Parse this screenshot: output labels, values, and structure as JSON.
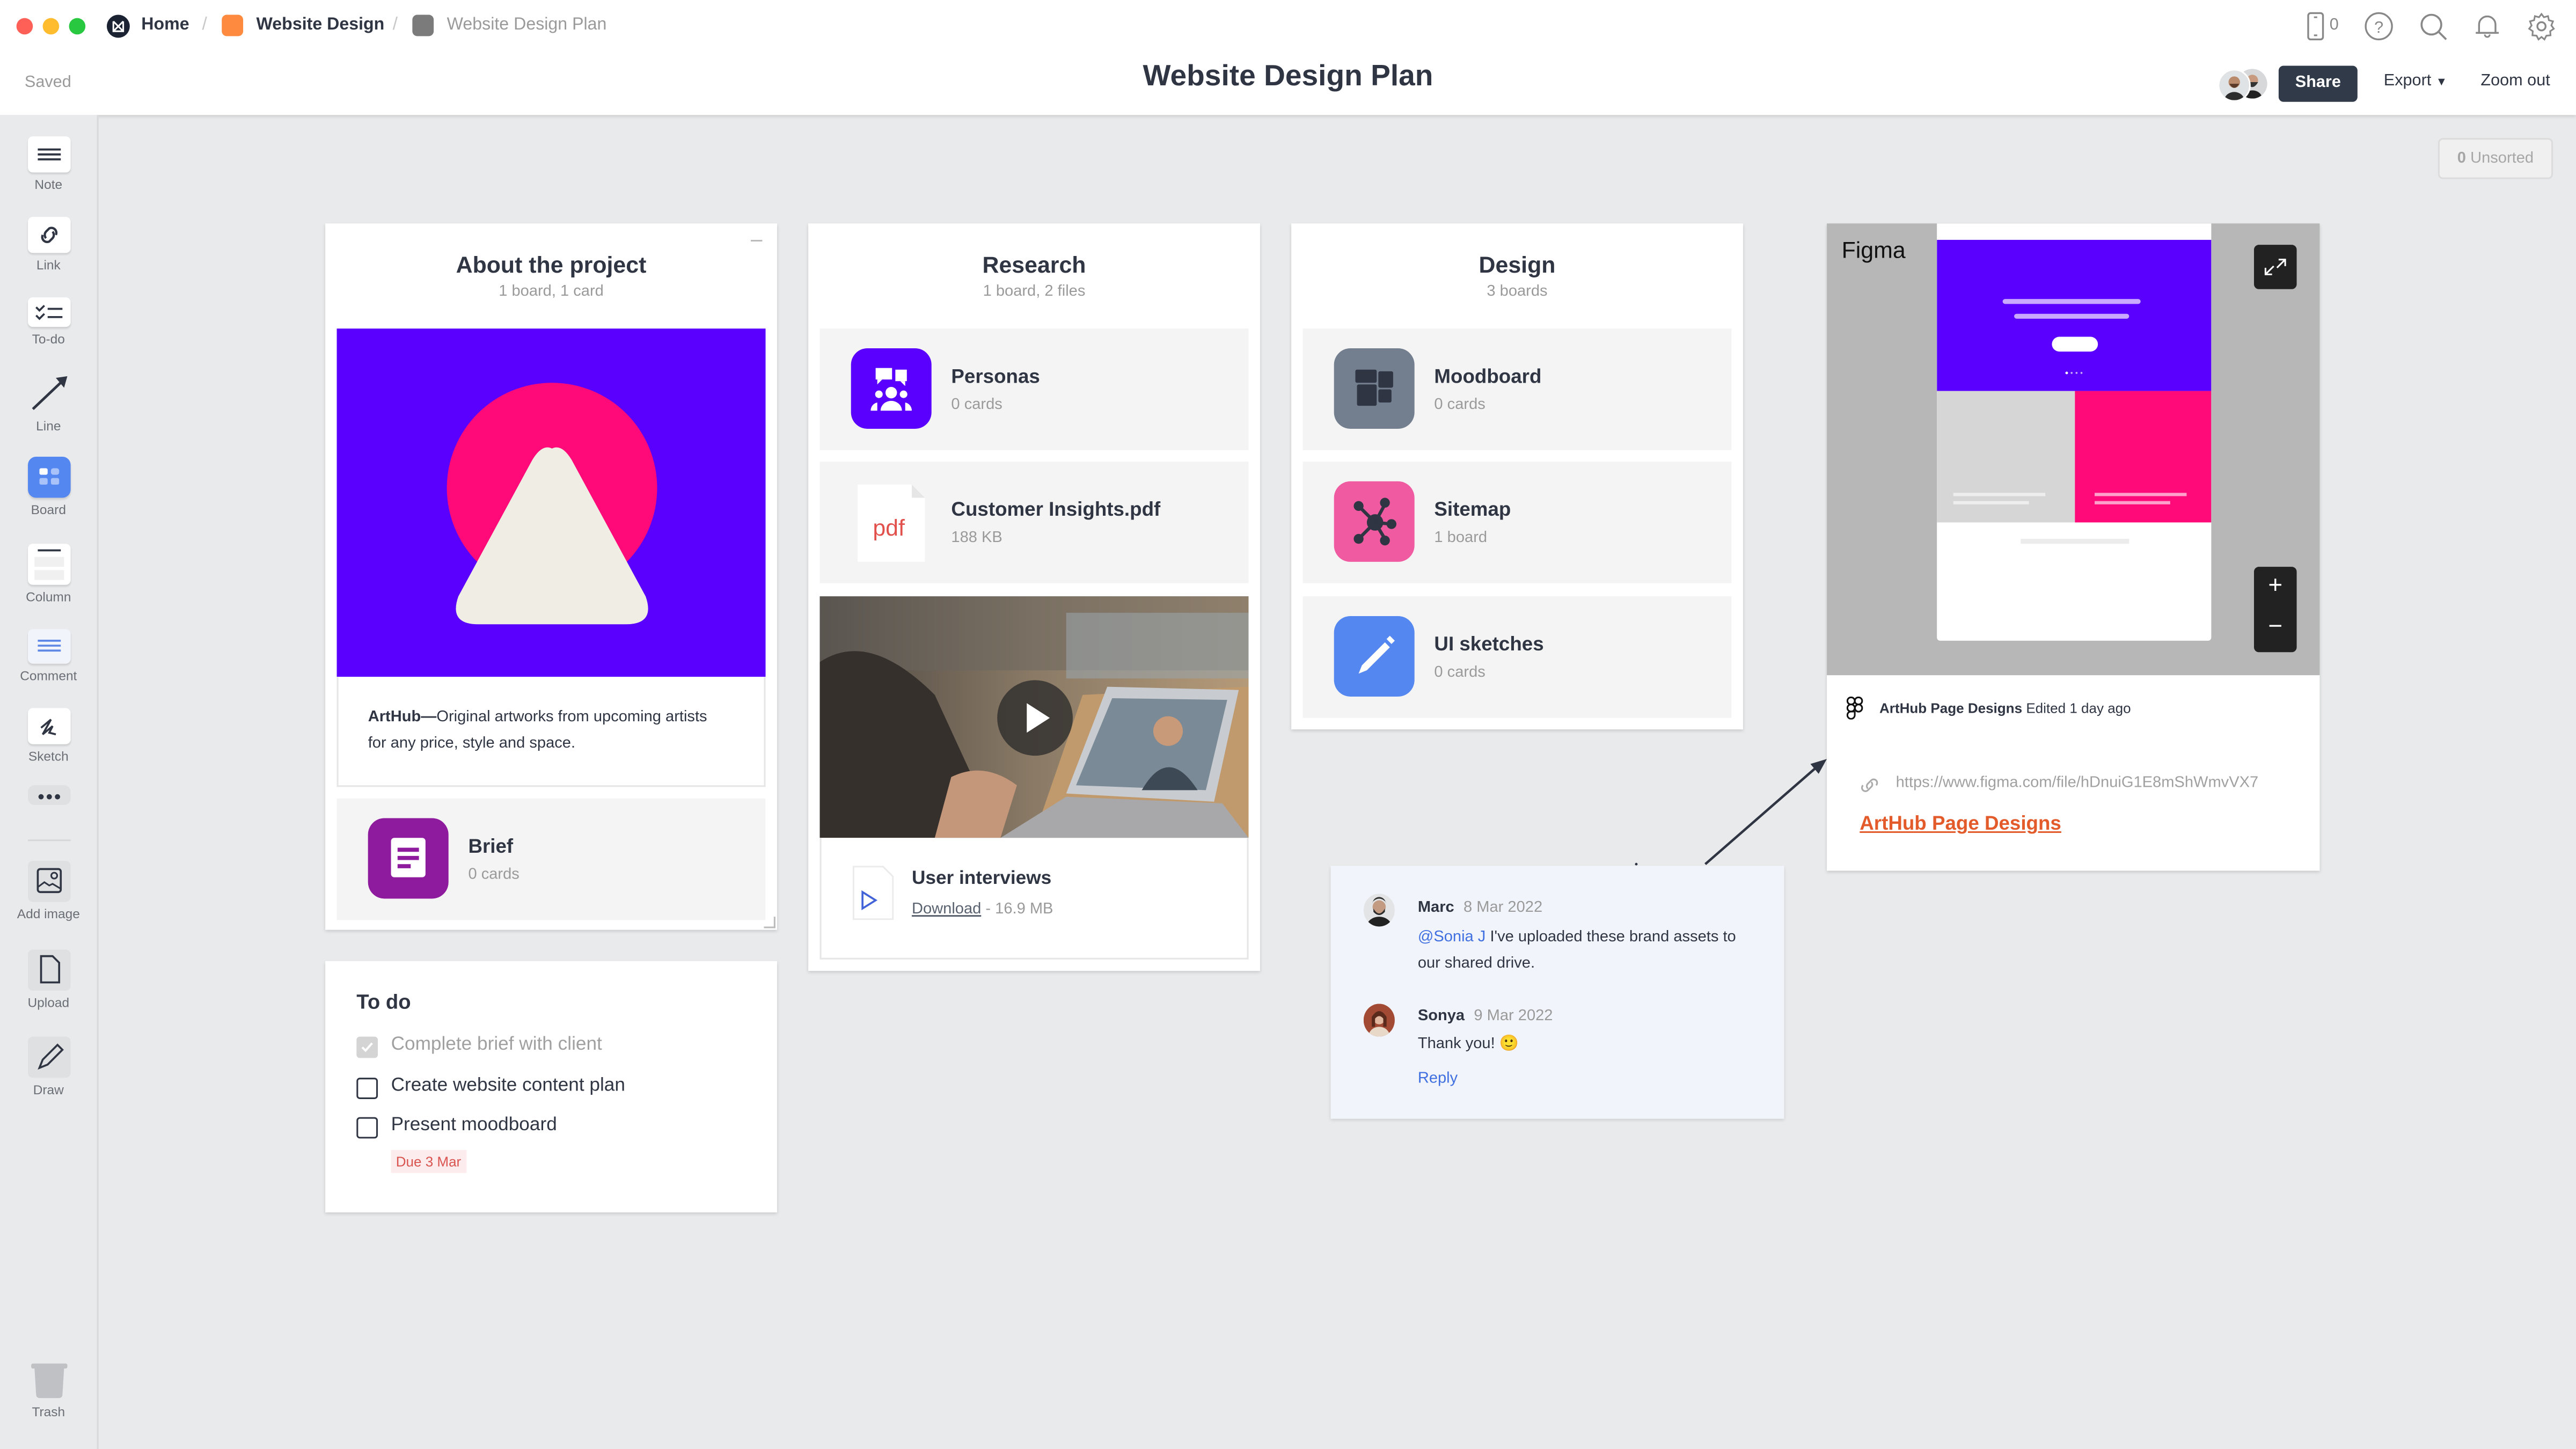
{
  "window": {
    "traffic_lights": {
      "close": "#fe5f57",
      "minimize": "#febc2e",
      "maximize": "#28c840"
    }
  },
  "breadcrumb": {
    "items": [
      {
        "label": "Home",
        "icon": "milanote-logo-icon",
        "color": "#1b2333"
      },
      {
        "label": "Website Design",
        "icon": "board-icon",
        "color": "#fd8a3e"
      },
      {
        "label": "Website Design Plan",
        "icon": "board-icon",
        "color": "#7b7b7b"
      }
    ],
    "separator": "/"
  },
  "header": {
    "title": "Website Design Plan",
    "status": "Saved",
    "device_count": "0",
    "share_label": "Share",
    "export_label": "Export",
    "zoom_out_label": "Zoom out",
    "icons": [
      "mobile-device-icon",
      "help-icon",
      "search-icon",
      "bell-icon",
      "gear-icon"
    ]
  },
  "unsorted": {
    "count": "0",
    "label": "Unsorted"
  },
  "sidebar": {
    "tools": [
      {
        "label": "Note",
        "icon": "note-icon"
      },
      {
        "label": "Link",
        "icon": "link-icon"
      },
      {
        "label": "To-do",
        "icon": "todo-icon"
      },
      {
        "label": "Line",
        "icon": "line-arrow-icon"
      },
      {
        "label": "Board",
        "icon": "board-icon"
      },
      {
        "label": "Column",
        "icon": "column-icon"
      },
      {
        "label": "Comment",
        "icon": "comment-icon"
      },
      {
        "label": "Sketch",
        "icon": "sketch-icon"
      },
      {
        "label": "",
        "icon": "more-icon"
      },
      {
        "label": "Add image",
        "icon": "image-icon"
      },
      {
        "label": "Upload",
        "icon": "file-icon"
      },
      {
        "label": "Draw",
        "icon": "pencil-icon"
      }
    ],
    "trash_label": "Trash"
  },
  "columns": {
    "about": {
      "title": "About the project",
      "subtitle": "1 board, 1 card",
      "note_bold": "ArtHub—",
      "note_text": "Original artworks from upcoming artists for any price, style and space.",
      "board": {
        "title": "Brief",
        "subtitle": "0 cards",
        "color": "#8e1a9d"
      },
      "art_colors": {
        "bg": "#5a00ff",
        "circle": "#ff0a78",
        "triangle": "#f0ede4"
      }
    },
    "research": {
      "title": "Research",
      "subtitle": "1 board, 2 files",
      "items": [
        {
          "title": "Personas",
          "subtitle": "0 cards",
          "color": "#5a00ff"
        },
        {
          "title": "Customer Insights.pdf",
          "subtitle": "188 KB",
          "file_type": "pdf"
        }
      ],
      "video": {
        "title": "User interviews",
        "download_label": "Download",
        "size": " - 16.9 MB"
      }
    },
    "design": {
      "title": "Design",
      "subtitle": "3 boards",
      "items": [
        {
          "title": "Moodboard",
          "subtitle": "0 cards",
          "color": "#737f8f"
        },
        {
          "title": "Sitemap",
          "subtitle": "1 board",
          "color": "#ef5aa0"
        },
        {
          "title": "UI sketches",
          "subtitle": "0 cards",
          "color": "#5587f0"
        }
      ]
    }
  },
  "todo": {
    "title": "To do",
    "items": [
      {
        "label": "Complete brief with client",
        "checked": true
      },
      {
        "label": "Create website content plan",
        "checked": false
      },
      {
        "label": "Present moodboard",
        "checked": false
      }
    ],
    "due_label": "Due 3 Mar"
  },
  "figma": {
    "brand": "Figma",
    "file_name": "ArtHub Page Designs",
    "edited": "Edited 1 day ago",
    "url": "https://www.figma.com/file/hDnuiG1E8mShWmvVX7",
    "link_title": "ArtHub Page Designs",
    "zoom_in": "+",
    "zoom_out": "−"
  },
  "comments": {
    "thread": [
      {
        "author": "Marc",
        "date": "8 Mar 2022",
        "mention": "@Sonia J",
        "text": " I've uploaded these brand assets to our shared drive."
      },
      {
        "author": "Sonya",
        "date": "9 Mar 2022",
        "mention": "",
        "text": "Thank you! 🙂"
      }
    ],
    "reply_label": "Reply"
  }
}
